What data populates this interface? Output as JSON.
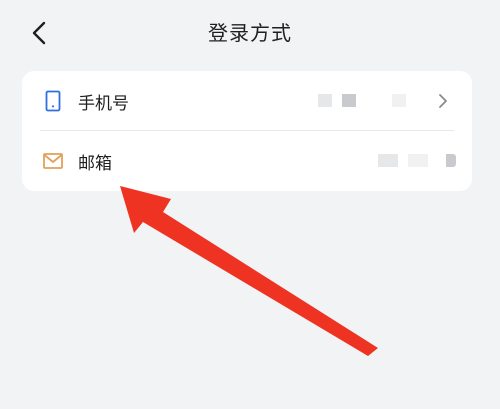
{
  "header": {
    "title": "登录方式",
    "back_icon": "chevron-left-icon"
  },
  "login_methods": [
    {
      "label": "手机号",
      "icon": "phone-icon",
      "icon_color": "#2f6fde",
      "value_masked": true,
      "has_chevron": true
    },
    {
      "label": "邮箱",
      "icon": "mail-icon",
      "icon_color": "#e0a15a",
      "value_masked": true,
      "has_chevron": false
    }
  ],
  "annotation": {
    "type": "red-arrow",
    "color": "#ee3322",
    "points_to": "邮箱"
  },
  "colors": {
    "background": "#f2f3f5",
    "card": "#ffffff"
  }
}
